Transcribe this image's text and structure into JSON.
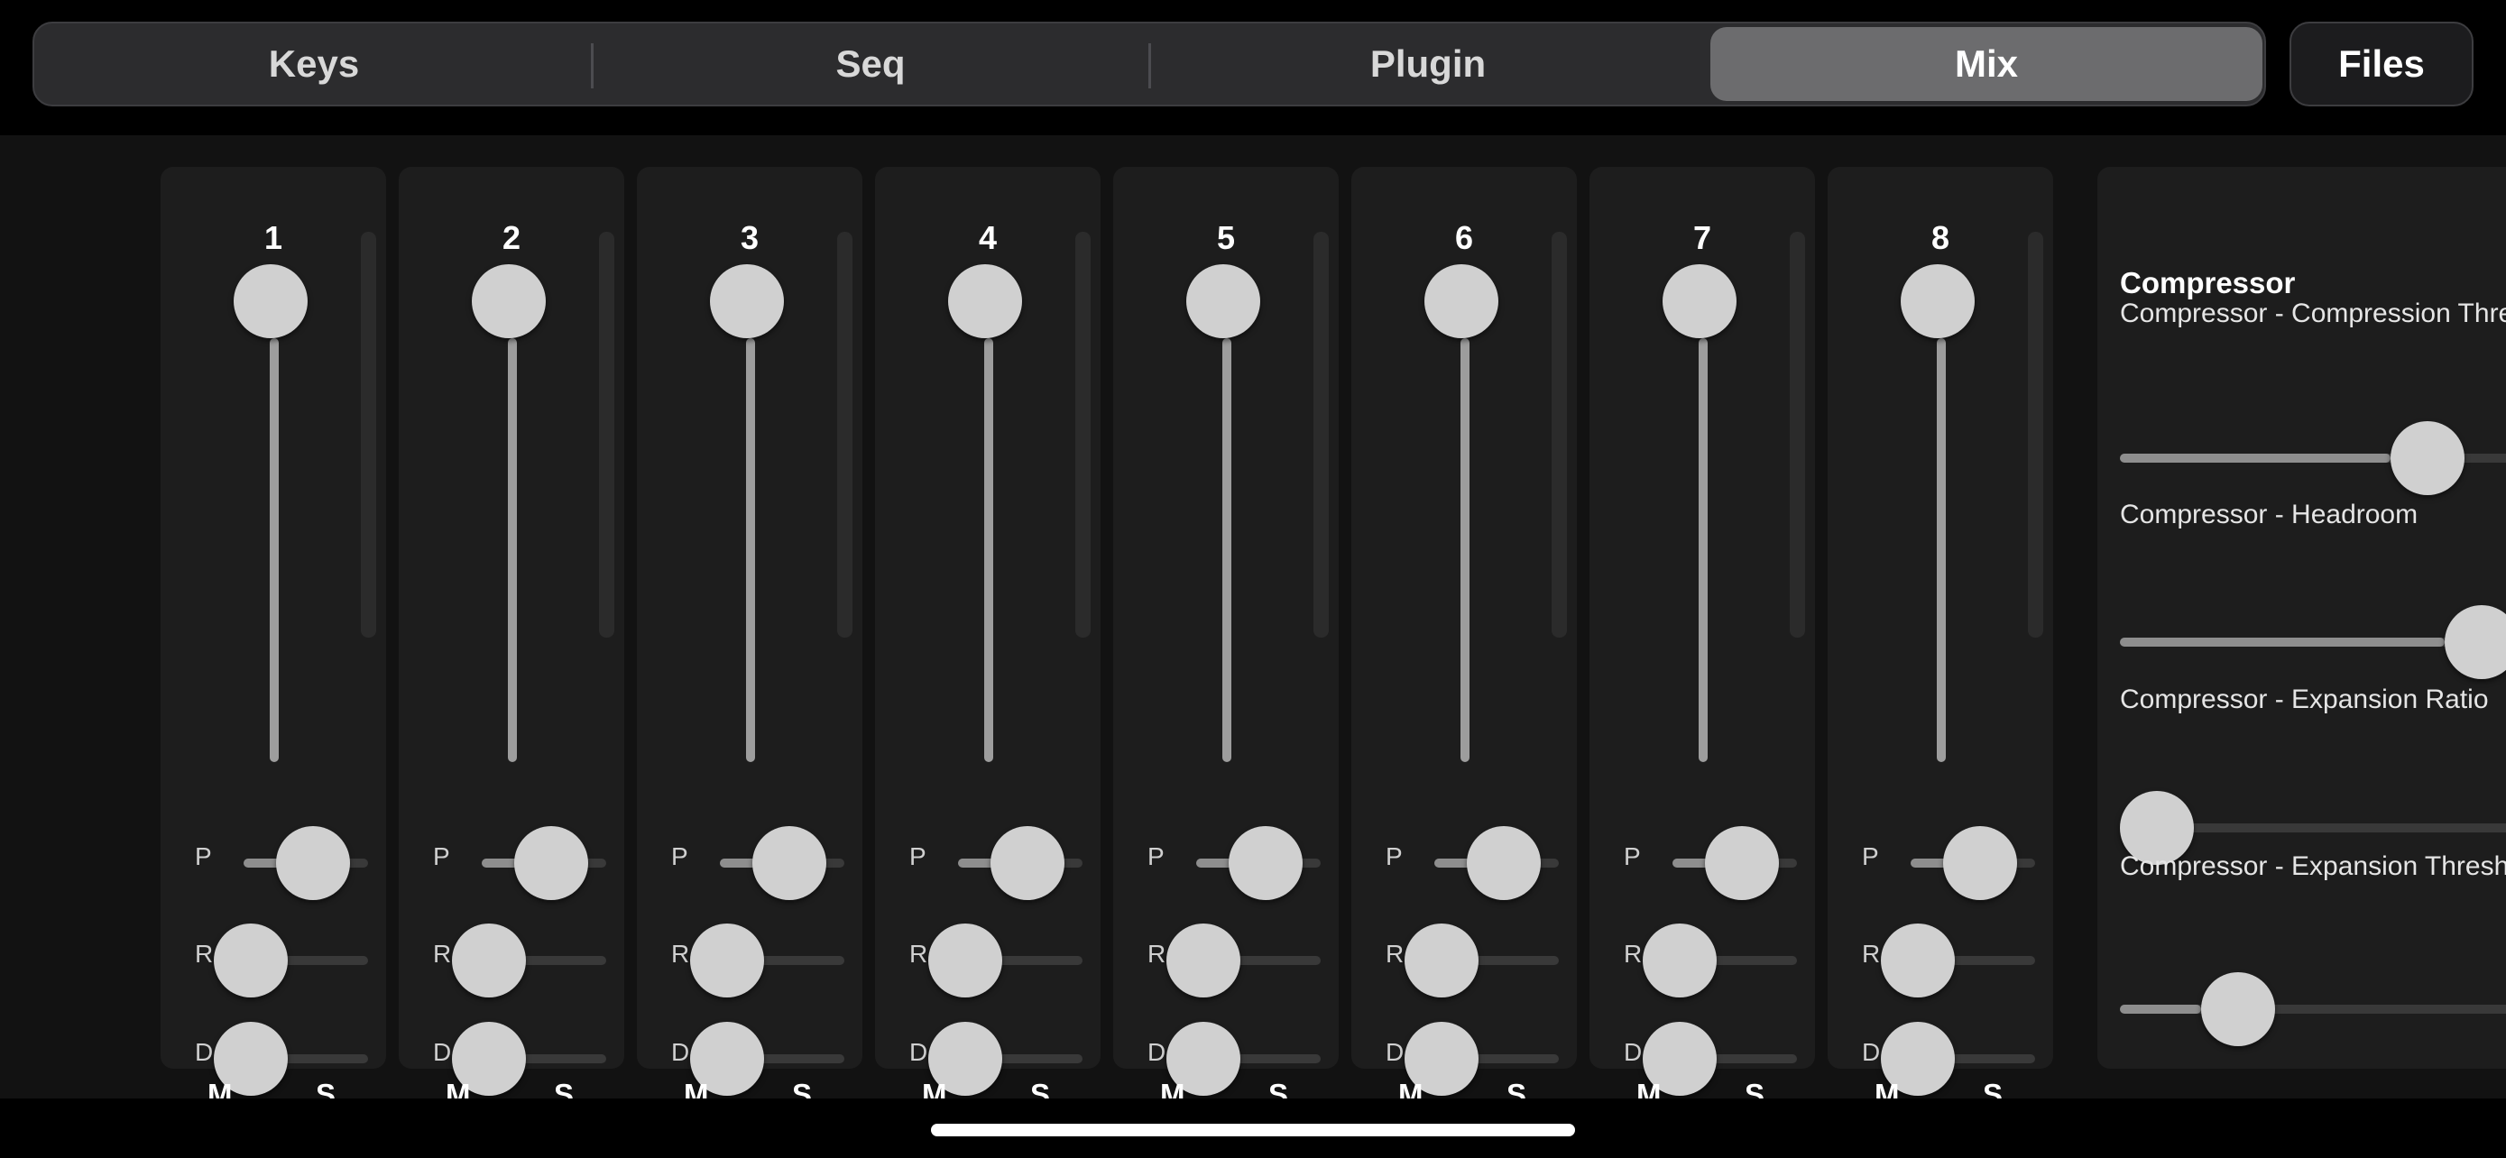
{
  "tabs": [
    {
      "label": "Keys",
      "active": false
    },
    {
      "label": "Seq",
      "active": false
    },
    {
      "label": "Plugin",
      "active": false
    },
    {
      "label": "Mix",
      "active": true
    }
  ],
  "files_label": "Files",
  "knob_labels": {
    "pan": "P",
    "reverb": "R",
    "delay": "D",
    "mute": "M",
    "solo": "S"
  },
  "channels": [
    {
      "number": "1",
      "volume": 1.0,
      "pan": 0.5,
      "reverb": 0.0,
      "delay": 0.0
    },
    {
      "number": "2",
      "volume": 1.0,
      "pan": 0.5,
      "reverb": 0.0,
      "delay": 0.0
    },
    {
      "number": "3",
      "volume": 1.0,
      "pan": 0.5,
      "reverb": 0.0,
      "delay": 0.0
    },
    {
      "number": "4",
      "volume": 1.0,
      "pan": 0.5,
      "reverb": 0.0,
      "delay": 0.0
    },
    {
      "number": "5",
      "volume": 1.0,
      "pan": 0.5,
      "reverb": 0.0,
      "delay": 0.0
    },
    {
      "number": "6",
      "volume": 1.0,
      "pan": 0.5,
      "reverb": 0.0,
      "delay": 0.0
    },
    {
      "number": "7",
      "volume": 1.0,
      "pan": 0.5,
      "reverb": 0.0,
      "delay": 0.0
    },
    {
      "number": "8",
      "volume": 1.0,
      "pan": 0.5,
      "reverb": 0.0,
      "delay": 0.0
    }
  ],
  "compressor": {
    "title": "Compressor",
    "params": [
      {
        "label": "Compressor - Compression Threshold",
        "value": 0.5
      },
      {
        "label": "Compressor - Headroom",
        "value": 0.6
      },
      {
        "label": "Compressor - Expansion Ratio",
        "value": 0.0
      },
      {
        "label": "Compressor - Expansion Threshold",
        "value": 0.15
      }
    ]
  }
}
